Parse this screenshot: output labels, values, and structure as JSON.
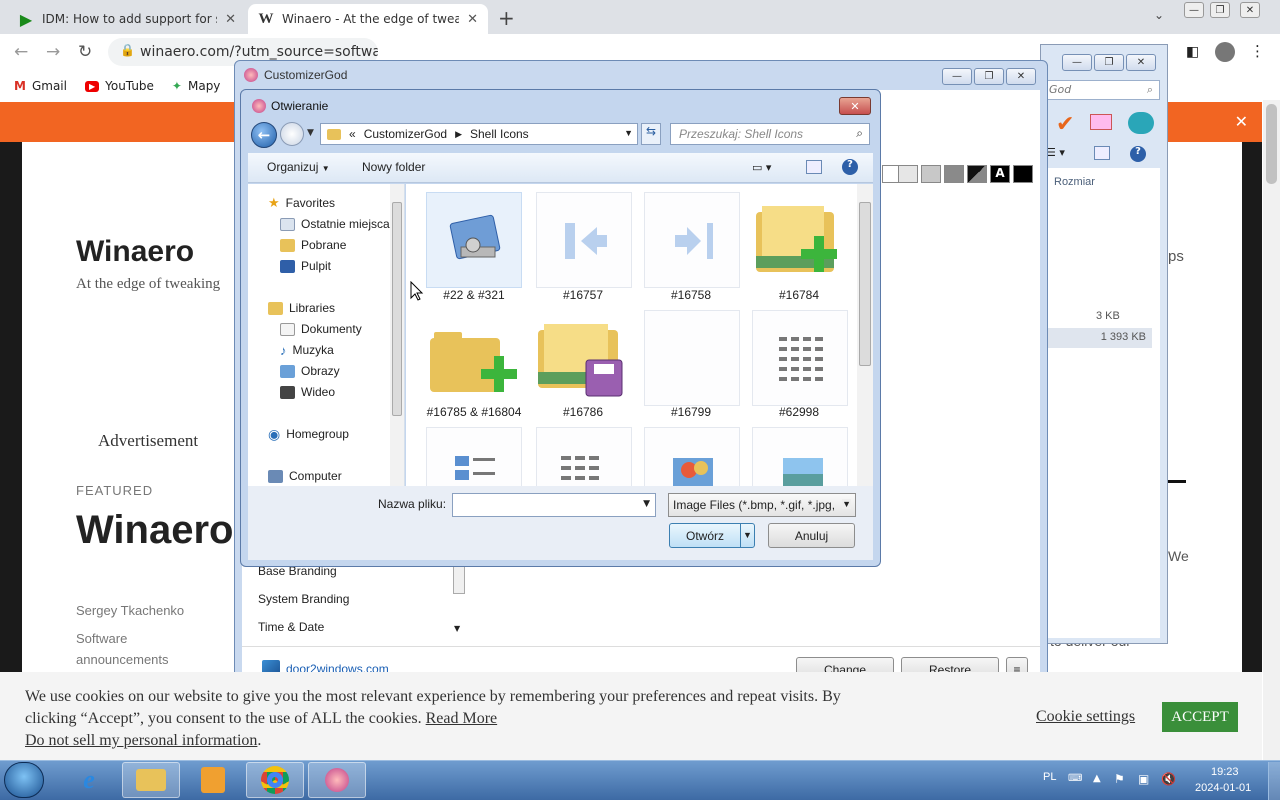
{
  "browser": {
    "tabs": [
      {
        "title": "IDM: How to add support for sha"
      },
      {
        "title": "Winaero - At the edge of tweaking"
      }
    ],
    "url": "winaero.com/?utm_source=software",
    "bookmarks": [
      "Gmail",
      "YouTube",
      "Mapy"
    ]
  },
  "site": {
    "title": "Winaero",
    "tagline": "At the edge of tweaking",
    "advertisement": "Advertisement",
    "featured_label": "FEATURED",
    "featured_title": "Winaero",
    "author": "Sergey Tkachenko",
    "category_line1": "Software",
    "category_line2": "announcements",
    "right_fragment_1": "ps",
    "right_fragment_2": "We",
    "right_fragment_3": "to deliver our",
    "cookie_text": "We use cookies on our website to give you the most relevant experience by remembering your preferences and repeat visits. By clicking “Accept”, you consent to the use of ALL the cookies.",
    "cookie_read_more": "Read More",
    "cookie_dnsmpi": "Do not sell my personal information",
    "cookie_settings": "Cookie settings",
    "cookie_accept": "ACCEPT"
  },
  "bg_window": {
    "search_placeholder": "God",
    "column_size": "Rozmiar",
    "size1": "3 KB",
    "size2": "1 393 KB"
  },
  "customizergod": {
    "title": "CustomizerGod",
    "sidebar": [
      "Base Branding",
      "System Branding",
      "Time & Date"
    ],
    "link": "door2windows.com",
    "change": "Change",
    "restore": "Restore",
    "menu": "≡"
  },
  "open_dialog": {
    "title": "Otwieranie",
    "breadcrumb": [
      "CustomizerGod",
      "Shell Icons"
    ],
    "search_placeholder": "Przeszukaj: Shell Icons",
    "organize": "Organizuj",
    "new_folder": "Nowy folder",
    "favorites": "Favorites",
    "fav_items": [
      "Ostatnie miejsca",
      "Pobrane",
      "Pulpit"
    ],
    "libraries": "Libraries",
    "lib_items": [
      "Dokumenty",
      "Muzyka",
      "Obrazy",
      "Wideo"
    ],
    "homegroup": "Homegroup",
    "computer": "Computer",
    "files": [
      "#22 & #321",
      "#16757",
      "#16758",
      "#16784",
      "#16785 & #16804",
      "#16786",
      "#16799",
      "#62998"
    ],
    "filename_label": "Nazwa pliku:",
    "filename_value": "",
    "filetype": "Image Files (*.bmp, *.gif, *.jpg,",
    "open": "Otwórz",
    "cancel": "Anuluj"
  },
  "taskbar": {
    "lang": "PL",
    "time": "19:23",
    "date": "2024-01-01"
  }
}
